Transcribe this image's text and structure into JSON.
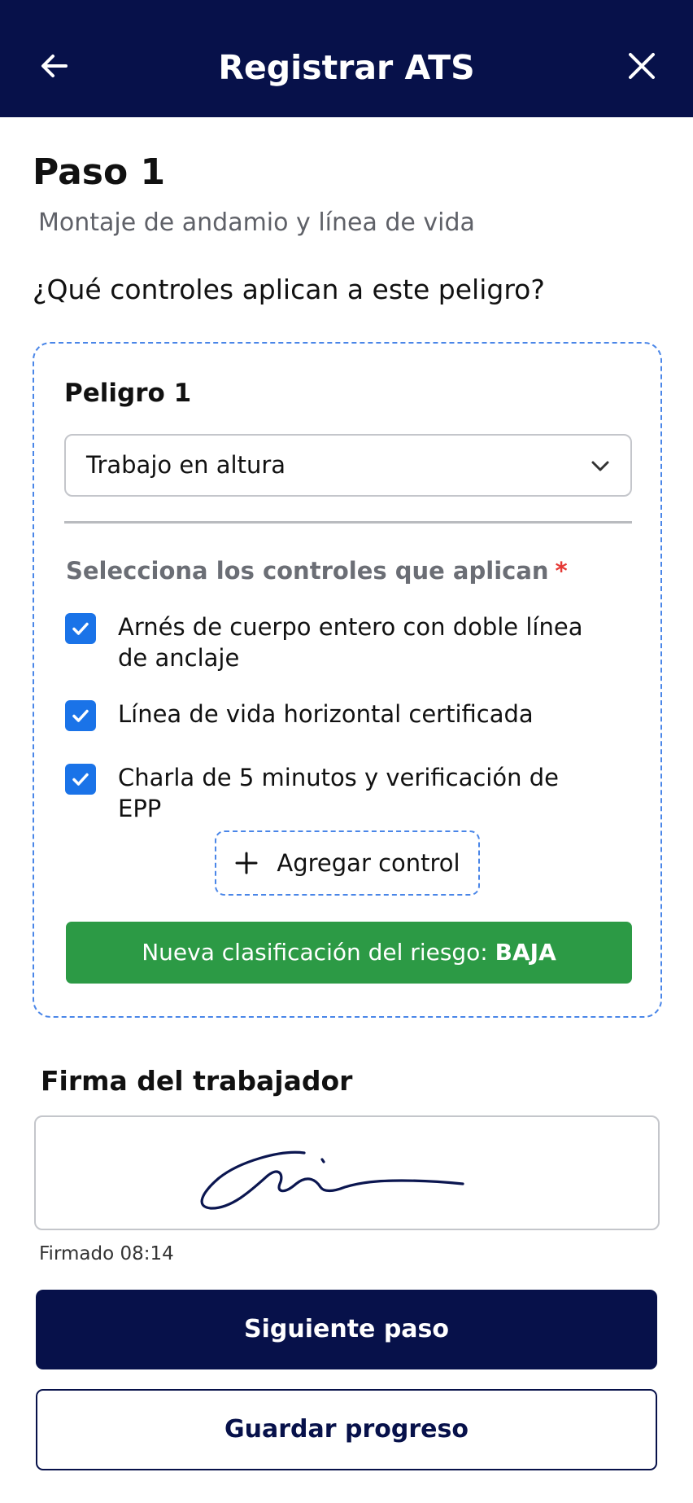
{
  "header": {
    "title": "Registrar ATS",
    "back_icon": "arrow-left-icon",
    "close_icon": "close-icon",
    "background_color": "#07114a"
  },
  "step": {
    "title": "Paso 1",
    "subtitle": "Montaje de andamio y línea de vida"
  },
  "question": "¿Qué controles aplican a este peligro?",
  "hazard": {
    "label": "Peligro 1",
    "selected_value": "Trabajo en altura",
    "controls_label": "Selecciona los controles que aplican",
    "required_mark": "*",
    "controls": [
      {
        "label": "Arnés de cuerpo entero con doble línea de anclaje",
        "checked": true
      },
      {
        "label": "Línea de vida horizontal certificada",
        "checked": true
      },
      {
        "label": "Charla de 5 minutos y verificación de EPP",
        "checked": true
      }
    ],
    "add_control_label": "Agregar control",
    "risk_prefix": "Nueva clasificación del riesgo:",
    "risk_value": "BAJA",
    "risk_color": "#2c9a45"
  },
  "signature": {
    "label": "Firma del trabajador",
    "signed_text": "Firmado 08:14"
  },
  "actions": {
    "next_label": "Siguiente paso",
    "save_label": "Guardar progreso"
  },
  "colors": {
    "primary": "#07114a",
    "accent": "#1a73e8",
    "required": "#e53935"
  }
}
